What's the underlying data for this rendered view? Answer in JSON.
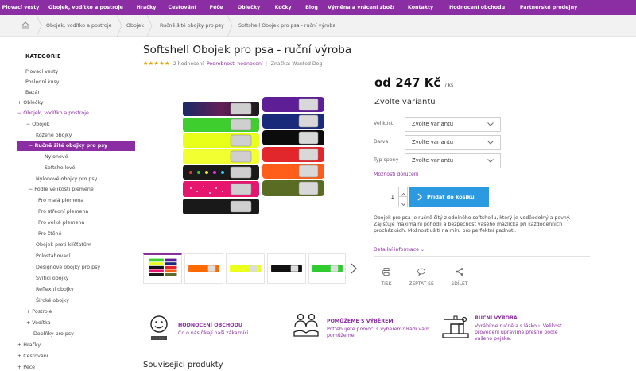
{
  "nav": {
    "items": [
      "Plovací vesty",
      "Obojek, vodítko a postroje",
      "Hračky",
      "Cestování",
      "Péče",
      "Oblečky",
      "Kočky",
      "Blog",
      "Výměna a vrácení zboží",
      "Kontakty",
      "Hodnocení obchodu",
      "Partnerské prodejny"
    ]
  },
  "breadcrumb": {
    "items": [
      "Obojek, vodítko a postroje",
      "Obojek",
      "Ručně šité obojky pro psy",
      "Softshell Obojek pro psa - ruční výroba"
    ]
  },
  "sidebar": {
    "title": "KATEGORIE",
    "items": [
      {
        "label": "Plovací vesty"
      },
      {
        "label": "Poslední kusy"
      },
      {
        "label": "Bazár"
      },
      {
        "label": "+ Oblečky"
      },
      {
        "label": "−  Obojek, vodítko a postroje"
      },
      {
        "label": "−  Obojek"
      },
      {
        "label": "Kožené obojky"
      },
      {
        "label": "−  Ručně šité obojky pro psy"
      },
      {
        "label": "Nylonové"
      },
      {
        "label": "Softshellové"
      },
      {
        "label": "Nylonové obojky pro psy"
      },
      {
        "label": "−  Podle velikosti plemene"
      },
      {
        "label": "Pro malá plemena"
      },
      {
        "label": "Pro střední plemena"
      },
      {
        "label": "Pro velká plemena"
      },
      {
        "label": "Pro štěně"
      },
      {
        "label": "Obojek proti klíšťatům"
      },
      {
        "label": "Polostahovací"
      },
      {
        "label": "Designové obojky pro psy"
      },
      {
        "label": "Svítící obojky"
      },
      {
        "label": "Reflexní obojky"
      },
      {
        "label": "Široké obojky"
      },
      {
        "label": "+ Postroje"
      },
      {
        "label": "+ Vodítka"
      },
      {
        "label": "Doplňky pro psy"
      },
      {
        "label": "+ Hračky"
      },
      {
        "label": "+ Cestování"
      },
      {
        "label": "+ Péče"
      }
    ]
  },
  "product": {
    "title": "Softshell Obojek pro psa - ruční výroba",
    "stars": "★★★★★",
    "reviews": "2 hodnocení",
    "review_link": "Podrobnosti hodnocení",
    "separator": "|",
    "brand": "Značka: Wanted Dog",
    "price": "od 247 Kč",
    "price_unit": "/ ks",
    "choose_variant": "Zvolte variantu",
    "fields": [
      {
        "label": "Velikost",
        "value": "Zvolte variantu"
      },
      {
        "label": "Barva",
        "value": "Zvolte variantu"
      },
      {
        "label": "Typ spony",
        "value": "Zvolte variantu"
      }
    ],
    "delivery": "Možnosti doručení",
    "quantity": "1",
    "add_to_cart": "Přidat do košíku",
    "description": "Obojek pro psa je ručně šitý z odolného softshellu, který je voděodolný a pevný. Zajišťuje maximální pohodlí a bezpečnost vašeho mazlíčka při každodenních procházkách. Možnost ušití na míru pro perfektní padnutí.",
    "more_info": "Detailní informace ⌄",
    "actions": [
      "TISK",
      "ZEPTAT SE",
      "SDÍLET"
    ]
  },
  "benefits": [
    {
      "title": "HODNOCENÍ OBCHODU",
      "text": "Co o nás říkají naši zákazníci"
    },
    {
      "title": "POMŮŽEME S VÝBĚREM",
      "text": "Potřebujete pomoci s výběrem? Rádi vám pomůžeme"
    },
    {
      "title": "RUČNÍ VÝROBA",
      "text": "Vyrábíme ručně a s láskou. Velikost i provedení upravíme přesně podle vašeho pejska."
    }
  ],
  "related": "Související produkty",
  "colors": {
    "brand": "#8c2ea3",
    "button": "#2b9ae0",
    "stars": "#e2a300"
  }
}
